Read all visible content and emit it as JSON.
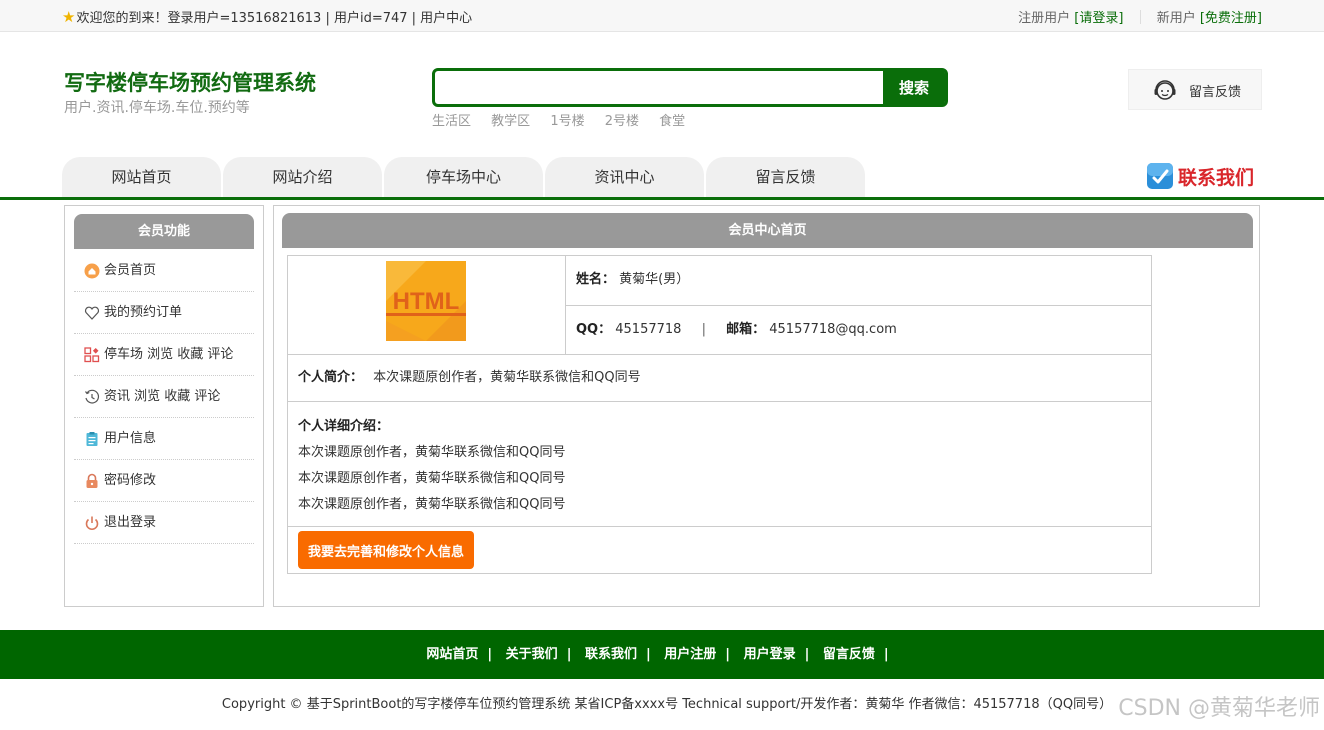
{
  "topbar": {
    "welcome": "欢迎您的到来！登录用户=13516821613 | 用户id=747 | 用户中心",
    "registered_prefix": "注册用户",
    "login_link": "[请登录]",
    "new_prefix": "新用户",
    "signup_link": "[免费注册]"
  },
  "header": {
    "title": "写字楼停车场预约管理系统",
    "subtitle": "用户.资讯.停车场.车位.预约等",
    "search": {
      "value": "",
      "placeholder": "",
      "button": "搜索"
    },
    "hot_tags": [
      "生活区",
      "教学区",
      "1号楼",
      "2号楼",
      "食堂"
    ],
    "feedback": "留言反馈"
  },
  "nav": {
    "items": [
      "网站首页",
      "网站介绍",
      "停车场中心",
      "资讯中心",
      "留言反馈"
    ],
    "contact": "联系我们"
  },
  "sidebar": {
    "title": "会员功能",
    "items": [
      {
        "label": "会员首页",
        "icon": "home-icon"
      },
      {
        "label": "我的预约订单",
        "icon": "heart-icon"
      },
      {
        "label": "停车场 浏览 收藏 评论",
        "icon": "grid-icon"
      },
      {
        "label": "资讯 浏览 收藏 评论",
        "icon": "history-icon"
      },
      {
        "label": "用户信息",
        "icon": "clipboard-icon"
      },
      {
        "label": "密码修改",
        "icon": "lock-icon"
      },
      {
        "label": "退出登录",
        "icon": "power-icon"
      }
    ]
  },
  "main": {
    "title": "会员中心首页",
    "logo_text": "HTML",
    "name_label": "姓名：",
    "name_value": "黄菊华(男）",
    "qq_label": "QQ：",
    "qq_value": "45157718",
    "divider": "|",
    "email_label": "邮箱：",
    "email_value": "45157718@qq.com",
    "intro_label": "个人简介：",
    "intro_value": "本次课题原创作者，黄菊华联系微信和QQ同号",
    "detail_label": "个人详细介绍：",
    "detail_lines": [
      "本次课题原创作者，黄菊华联系微信和QQ同号",
      "本次课题原创作者，黄菊华联系微信和QQ同号",
      "本次课题原创作者，黄菊华联系微信和QQ同号"
    ],
    "edit_button": "我要去完善和修改个人信息"
  },
  "footer": {
    "links": [
      "网站首页",
      "关于我们",
      "联系我们",
      "用户注册",
      "用户登录",
      "留言反馈"
    ],
    "pipe": "|",
    "copyright": "Copyright © 基于SprintBoot的写字楼停车位预约管理系统    某省ICP备xxxx号    Technical support/开发作者：黄菊华    作者微信：45157718（QQ同号）"
  },
  "watermark": "CSDN @黄菊华老师",
  "colors": {
    "brand_green": "#0a6e0a",
    "footer_green": "#006600",
    "accent_orange": "#f96b00",
    "contact_red": "#d9262b"
  }
}
